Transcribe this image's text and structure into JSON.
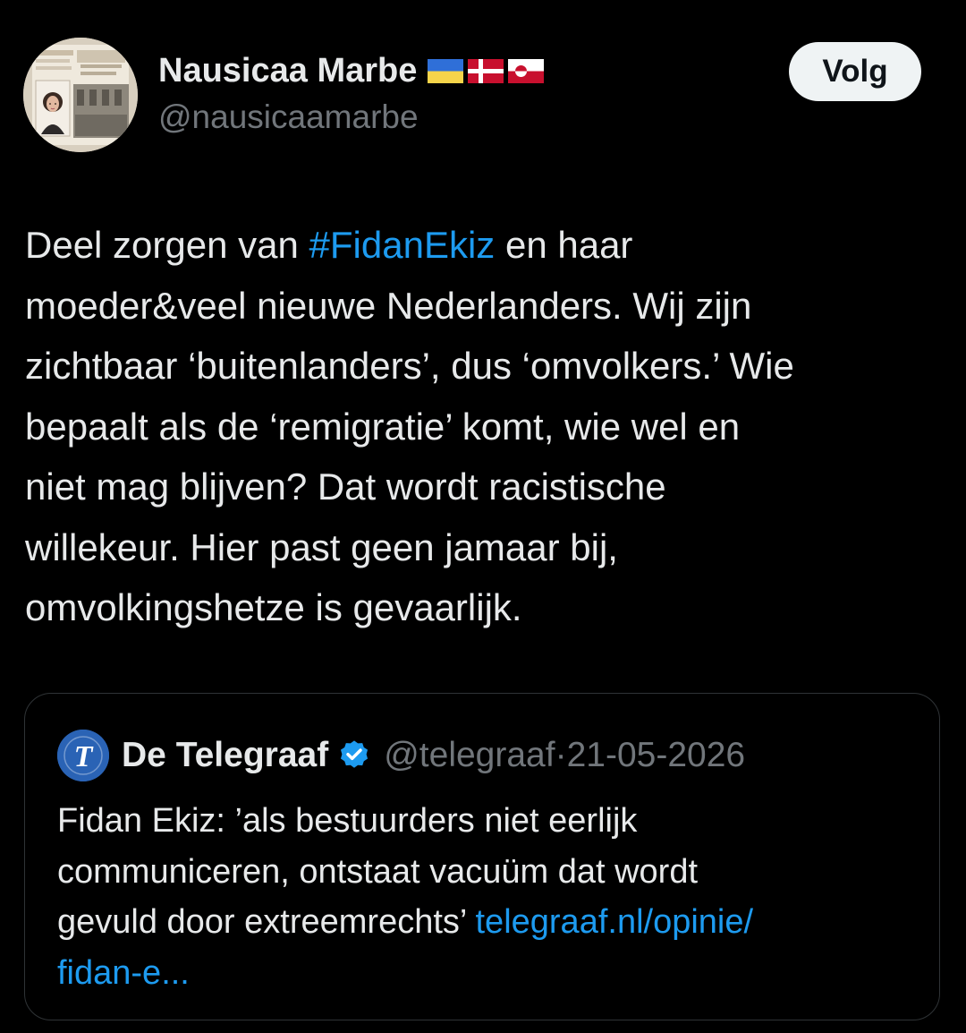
{
  "author": {
    "name": "Nausicaa Marbe",
    "handle": "@nausicaamarbe",
    "flags": [
      "ukraine-flag",
      "denmark-flag",
      "greenland-flag"
    ],
    "avatar_book_title": "Wachten in het Westen",
    "avatar_book_author": "Nausicaa Marbe"
  },
  "follow_button": {
    "label": "Volg"
  },
  "tweet": {
    "lines": [
      {
        "before": "Deel zorgen van ",
        "hashtag": "#FidanEkiz",
        "after": " en haar"
      },
      {
        "text": "moeder&veel nieuwe Nederlanders. Wij zijn"
      },
      {
        "text": "zichtbaar ‘buitenlanders’, dus ‘omvolkers.’ Wie"
      },
      {
        "text": "bepaalt als de ‘remigratie’ komt, wie wel en"
      },
      {
        "text": "niet mag blijven? Dat wordt racistische"
      },
      {
        "text": "willekeur. Hier past geen jamaar bij,"
      },
      {
        "text": "omvolkingshetze is gevaarlijk."
      }
    ]
  },
  "quote": {
    "name": "De Telegraaf",
    "handle": "@telegraaf",
    "separator": "·",
    "date": "21-05-2026",
    "logo_icon": "telegraaf-logo-icon",
    "verified_icon": "verified-badge-icon",
    "lines": [
      {
        "text": "Fidan Ekiz: ’als bestuurders niet eerlijk"
      },
      {
        "text": "communiceren, ontstaat vacuüm dat wordt"
      },
      {
        "before": "gevuld door extreemrechts’ ",
        "link": "telegraaf.nl/opinie/"
      },
      {
        "link": "fidan-e..."
      }
    ]
  },
  "colors": {
    "background": "#000000",
    "text": "#e7e9ea",
    "secondary": "#71767b",
    "accent": "#1d9bf0",
    "border": "#2f3336",
    "follow_bg": "#eff3f4",
    "telegraaf_blue": "#2a63b5"
  }
}
